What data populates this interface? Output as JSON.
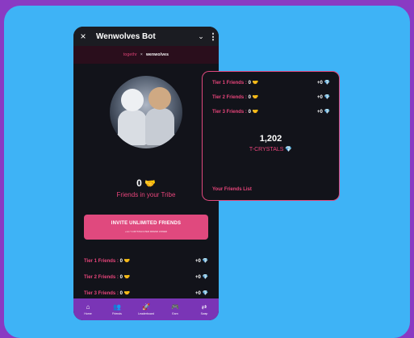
{
  "window": {
    "title": "Wenwolves Bot",
    "close_icon": "×",
    "chevron_icon": "⌄",
    "menu_icon": "⋮"
  },
  "brand": {
    "left": "togethr",
    "sep": "×",
    "right": "wenwolves"
  },
  "tribe": {
    "count": "0",
    "handshake": "🤝",
    "label": "Friends in your Tribe"
  },
  "invite": {
    "label": "INVITE UNLIMITED FRIENDS",
    "sub": "+xxx T-CRYSTALS PER FRIEND JOINED"
  },
  "tiers": [
    {
      "label": "Tier 1 Friends :",
      "count": "0",
      "handshake": "🤝",
      "reward": "+0",
      "gem": "💎"
    },
    {
      "label": "Tier 2 Friends :",
      "count": "0",
      "handshake": "🤝",
      "reward": "+0",
      "gem": "💎"
    },
    {
      "label": "Tier 3 Friends :",
      "count": "0",
      "handshake": "🤝",
      "reward": "+0",
      "gem": "💎"
    }
  ],
  "nav": [
    {
      "label": "Home",
      "icon": "home-icon",
      "glyph": "⌂"
    },
    {
      "label": "Friends",
      "icon": "friends-icon",
      "glyph": "👥"
    },
    {
      "label": "Leaderboard",
      "icon": "rocket-icon",
      "glyph": "🚀"
    },
    {
      "label": "Earn",
      "icon": "gamepad-icon",
      "glyph": "🎮"
    },
    {
      "label": "Swap",
      "icon": "swap-icon",
      "glyph": "⇄"
    }
  ],
  "panel": {
    "crystals": "1,202",
    "crystals_label": "T-CRYSTALS",
    "gem": "💎",
    "friends_list": "Your Friends List"
  },
  "colors": {
    "accent": "#e0497e",
    "nav": "#7a35b6",
    "background": "#3eb3f6",
    "border": "#8a3ac3"
  }
}
